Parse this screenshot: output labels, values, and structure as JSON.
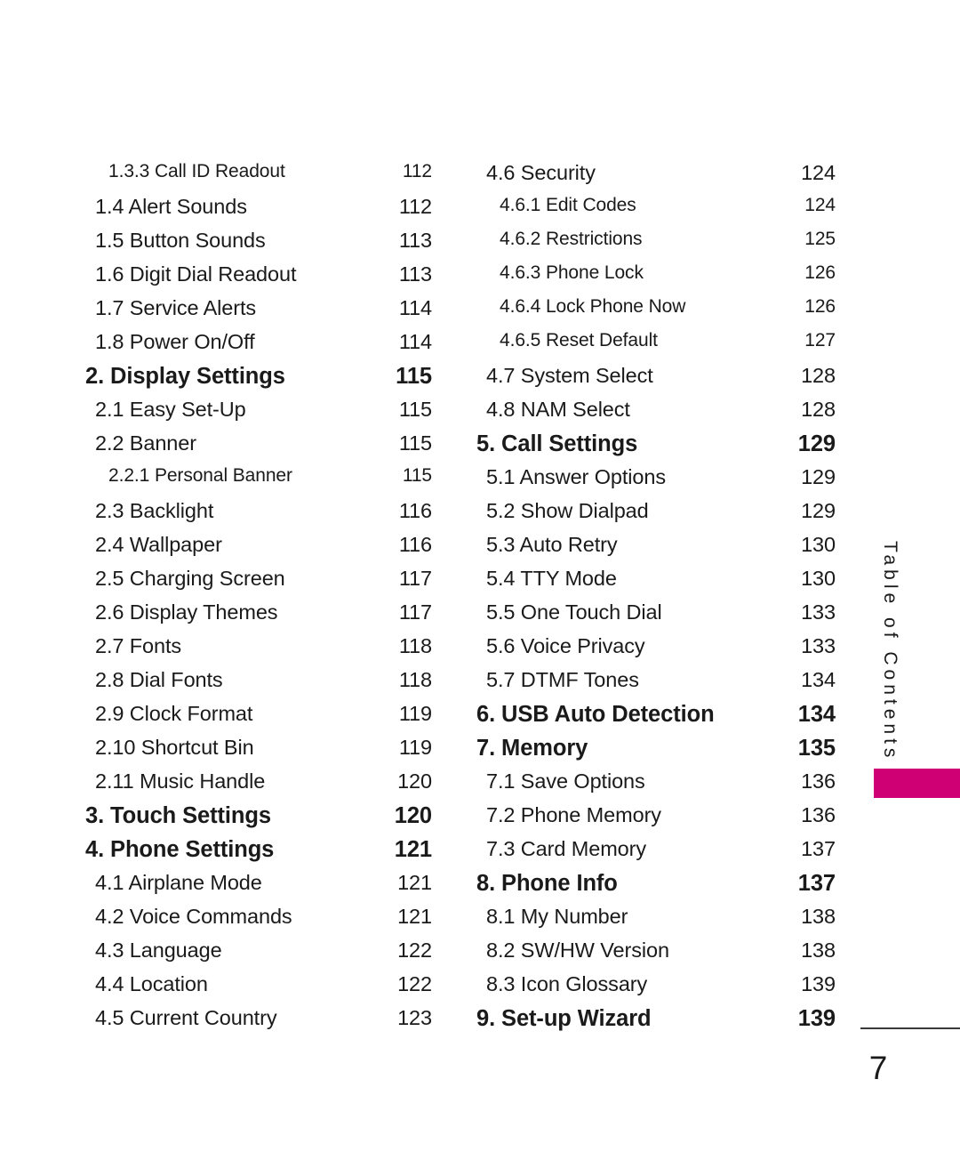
{
  "page": {
    "number": "7",
    "side_label": "Table of Contents",
    "accent_color": "#ce0073"
  },
  "toc": {
    "left_column": [
      {
        "level": 3,
        "title": "1.3.3 Call ID Readout",
        "page": "112"
      },
      {
        "level": 2,
        "title": "1.4 Alert Sounds",
        "page": "112"
      },
      {
        "level": 2,
        "title": "1.5 Button Sounds",
        "page": "113"
      },
      {
        "level": 2,
        "title": "1.6 Digit Dial Readout",
        "page": "113"
      },
      {
        "level": 2,
        "title": "1.7 Service Alerts",
        "page": "114"
      },
      {
        "level": 2,
        "title": "1.8 Power On/Off",
        "page": "114"
      },
      {
        "level": 1,
        "title": "2. Display Settings",
        "page": "115"
      },
      {
        "level": 2,
        "title": "2.1 Easy Set-Up",
        "page": "115"
      },
      {
        "level": 2,
        "title": "2.2 Banner",
        "page": "115"
      },
      {
        "level": 3,
        "title": "2.2.1 Personal Banner",
        "page": "115"
      },
      {
        "level": 2,
        "title": "2.3 Backlight",
        "page": "116"
      },
      {
        "level": 2,
        "title": "2.4 Wallpaper",
        "page": "116"
      },
      {
        "level": 2,
        "title": "2.5 Charging Screen",
        "page": "117"
      },
      {
        "level": 2,
        "title": "2.6 Display Themes",
        "page": "117"
      },
      {
        "level": 2,
        "title": "2.7 Fonts",
        "page": "118"
      },
      {
        "level": 2,
        "title": "2.8 Dial Fonts",
        "page": "118"
      },
      {
        "level": 2,
        "title": "2.9 Clock Format",
        "page": "119"
      },
      {
        "level": 2,
        "title": "2.10 Shortcut Bin",
        "page": "119"
      },
      {
        "level": 2,
        "title": "2.11 Music Handle",
        "page": "120"
      },
      {
        "level": 1,
        "title": "3. Touch Settings",
        "page": "120"
      },
      {
        "level": 1,
        "title": "4. Phone Settings",
        "page": "121"
      },
      {
        "level": 2,
        "title": "4.1 Airplane Mode",
        "page": "121"
      },
      {
        "level": 2,
        "title": "4.2 Voice Commands",
        "page": "121"
      },
      {
        "level": 2,
        "title": "4.3 Language",
        "page": "122"
      },
      {
        "level": 2,
        "title": "4.4 Location",
        "page": "122"
      },
      {
        "level": 2,
        "title": "4.5 Current Country",
        "page": "123"
      }
    ],
    "right_column": [
      {
        "level": 2,
        "title": "4.6 Security",
        "page": "124"
      },
      {
        "level": 3,
        "title": "4.6.1 Edit Codes",
        "page": "124"
      },
      {
        "level": 3,
        "title": "4.6.2 Restrictions",
        "page": "125"
      },
      {
        "level": 3,
        "title": "4.6.3 Phone Lock",
        "page": "126"
      },
      {
        "level": 3,
        "title": "4.6.4 Lock Phone Now",
        "page": "126"
      },
      {
        "level": 3,
        "title": "4.6.5 Reset Default",
        "page": "127"
      },
      {
        "level": 2,
        "title": "4.7 System Select",
        "page": "128"
      },
      {
        "level": 2,
        "title": "4.8 NAM Select",
        "page": "128"
      },
      {
        "level": 1,
        "title": "5. Call Settings",
        "page": "129"
      },
      {
        "level": 2,
        "title": "5.1 Answer Options",
        "page": "129"
      },
      {
        "level": 2,
        "title": "5.2 Show Dialpad",
        "page": "129"
      },
      {
        "level": 2,
        "title": "5.3 Auto Retry",
        "page": "130"
      },
      {
        "level": 2,
        "title": "5.4 TTY Mode",
        "page": "130"
      },
      {
        "level": 2,
        "title": "5.5 One Touch Dial",
        "page": "133"
      },
      {
        "level": 2,
        "title": "5.6 Voice Privacy",
        "page": "133"
      },
      {
        "level": 2,
        "title": "5.7 DTMF Tones",
        "page": "134"
      },
      {
        "level": 1,
        "title": "6. USB Auto Detection",
        "page": "134"
      },
      {
        "level": 1,
        "title": "7. Memory",
        "page": "135"
      },
      {
        "level": 2,
        "title": "7.1 Save Options",
        "page": "136"
      },
      {
        "level": 2,
        "title": "7.2 Phone Memory",
        "page": "136"
      },
      {
        "level": 2,
        "title": "7.3 Card Memory",
        "page": "137"
      },
      {
        "level": 1,
        "title": "8. Phone Info",
        "page": "137"
      },
      {
        "level": 2,
        "title": "8.1 My Number",
        "page": "138"
      },
      {
        "level": 2,
        "title": "8.2 SW/HW Version",
        "page": "138"
      },
      {
        "level": 2,
        "title": "8.3 Icon Glossary",
        "page": "139"
      },
      {
        "level": 1,
        "title": "9. Set-up Wizard",
        "page": "139"
      }
    ]
  }
}
